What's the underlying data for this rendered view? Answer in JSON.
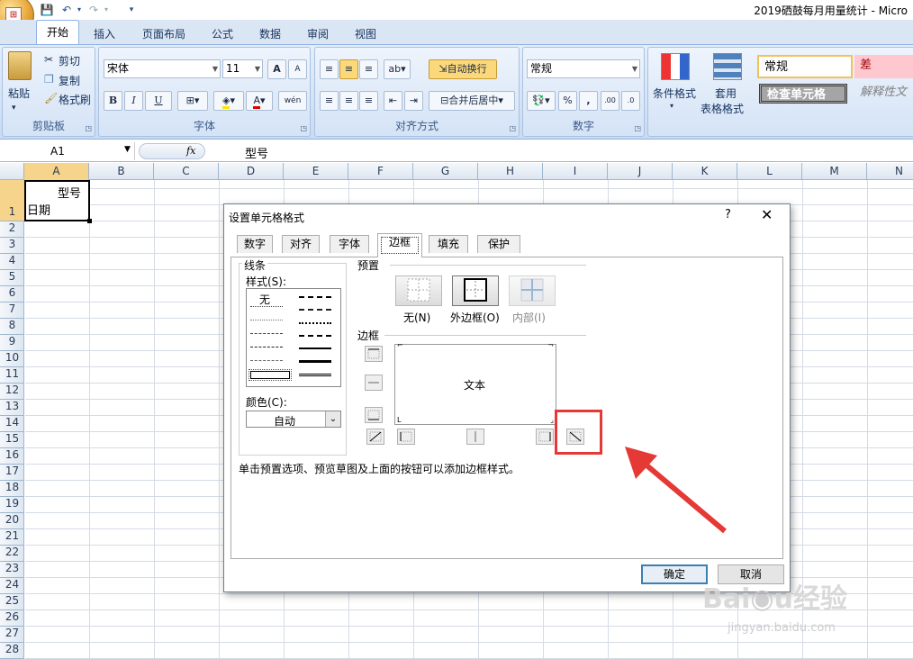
{
  "window": {
    "title": "2019硒鼓每月用量统计 - Micro"
  },
  "quick_access": [
    "save-icon",
    "undo-icon",
    "redo-icon",
    "customize-icon"
  ],
  "ribbon_tabs": [
    "开始",
    "插入",
    "页面布局",
    "公式",
    "数据",
    "审阅",
    "视图"
  ],
  "clipboard": {
    "paste": "粘贴",
    "cut": "剪切",
    "copy": "复制",
    "format_painter": "格式刷",
    "label": "剪贴板"
  },
  "font": {
    "name": "宋体",
    "size": "11",
    "grow": "A",
    "shrink": "A",
    "bold": "B",
    "italic": "I",
    "underline": "U",
    "label": "字体",
    "phonetic": "wén"
  },
  "alignment": {
    "wrap": "自动换行",
    "merge": "合并后居中",
    "label": "对齐方式"
  },
  "number": {
    "format": "常规",
    "percent": "%",
    "comma": ",",
    "label": "数字"
  },
  "styles": {
    "conditional": "条件格式",
    "table_format_1": "套用",
    "table_format_2": "表格格式",
    "normal": "常规",
    "bad": "差",
    "check_cell": "检查单元格",
    "explanatory": "解释性文"
  },
  "formula_bar": {
    "name_box": "A1",
    "fx": "fx",
    "content": "型号"
  },
  "columns": [
    "A",
    "B",
    "C",
    "D",
    "E",
    "F",
    "G",
    "H",
    "I",
    "J",
    "K",
    "L",
    "M",
    "N"
  ],
  "rows": [
    "1",
    "2",
    "3",
    "4",
    "5",
    "6",
    "7",
    "8",
    "9",
    "10",
    "11",
    "12",
    "13",
    "14",
    "15",
    "16",
    "17",
    "18",
    "19",
    "20",
    "21",
    "22",
    "23",
    "24",
    "25",
    "26",
    "27",
    "28"
  ],
  "cell_a1": {
    "line1": "型号",
    "line2": "日期"
  },
  "dialog": {
    "title": "设置单元格格式",
    "help": "?",
    "close": "✕",
    "tabs": [
      "数字",
      "对齐",
      "字体",
      "边框",
      "填充",
      "保护"
    ],
    "selected_tab": "边框",
    "line_group": "线条",
    "style_label": "样式(S):",
    "style_none": "无",
    "color_label": "颜色(C):",
    "color_value": "自动",
    "preset_label": "预置",
    "preset_none": "无(N)",
    "preset_outline": "外边框(O)",
    "preset_inside": "内部(I)",
    "border_label": "边框",
    "preview_text": "文本",
    "hint": "单击预置选项、预览草图及上面的按钮可以添加边框样式。",
    "ok": "确定",
    "cancel": "取消"
  },
  "annotation": {
    "highlight_color": "#e53935",
    "arrow_color": "#e53935"
  },
  "watermark": {
    "brand": "Baidu经验",
    "url": "jingyan.baidu.com"
  }
}
